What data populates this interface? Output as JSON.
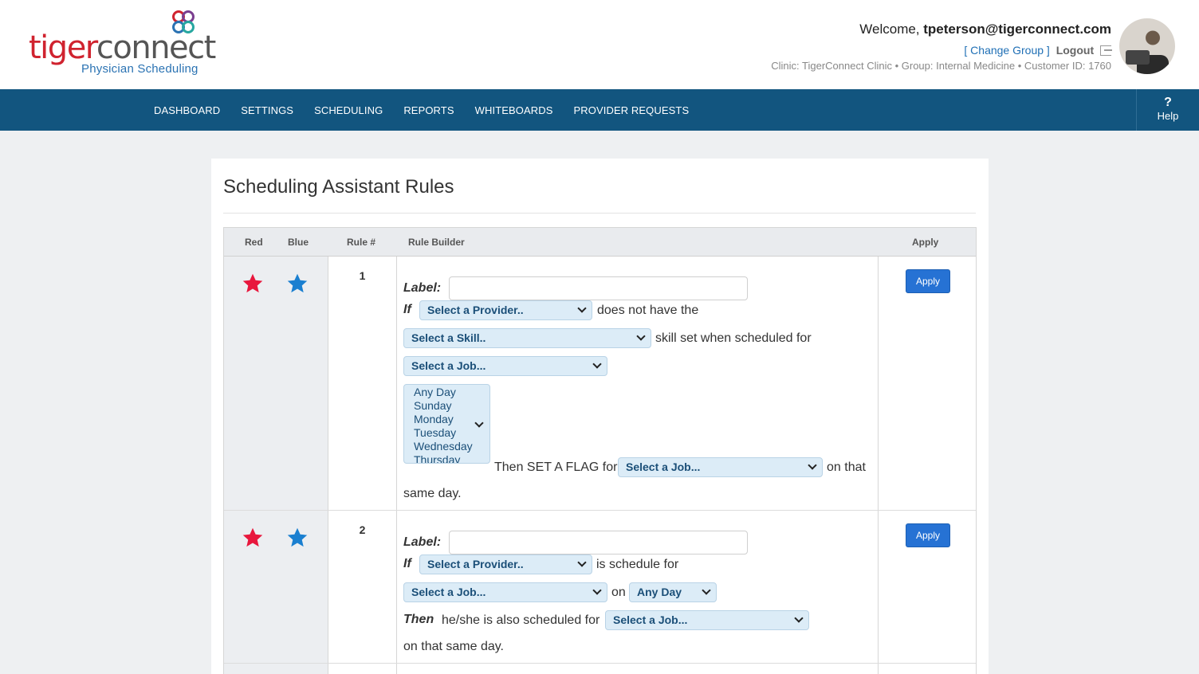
{
  "brand": {
    "name_part1": "tiger",
    "name_part2": "connect",
    "subtitle": "Physician Scheduling"
  },
  "user": {
    "welcome_prefix": "Welcome,",
    "email": "tpeterson@tigerconnect.com",
    "change_group": "[ Change Group ]",
    "logout": "Logout",
    "clinic_line": "Clinic: TigerConnect Clinic • Group: Internal Medicine • Customer ID: 1760"
  },
  "nav": {
    "items": [
      "DASHBOARD",
      "SETTINGS",
      "SCHEDULING",
      "REPORTS",
      "WHITEBOARDS",
      "PROVIDER REQUESTS"
    ],
    "help_glyph": "?",
    "help_label": "Help"
  },
  "page": {
    "title": "Scheduling Assistant Rules"
  },
  "table": {
    "headers": {
      "red": "Red",
      "blue": "Blue",
      "rule_num": "Rule #",
      "builder": "Rule Builder",
      "apply": "Apply"
    },
    "apply_label": "Apply",
    "label_text": "Label:",
    "if_text": "If",
    "colors": {
      "red_star": "#e8173d",
      "blue_star": "#1a7fd0"
    },
    "rules": [
      {
        "number": "1",
        "label_value": "",
        "provider_select": "Select a Provider..",
        "text_does_not_have": "does not have the",
        "skill_select": "Select a Skill..",
        "text_skill_set": "skill set when scheduled for",
        "job_select": "Select a Job...",
        "day_options": [
          "Any Day",
          "Sunday",
          "Monday",
          "Tuesday",
          "Wednesday",
          "Thursday"
        ],
        "text_then_flag": "Then SET A FLAG for",
        "flag_job_select": "Select a Job...",
        "text_on_that": "on that",
        "text_same_day": "same day."
      },
      {
        "number": "2",
        "label_value": "",
        "provider_select": "Select a Provider..",
        "text_is_schedule_for": "is schedule for",
        "job_select": "Select a Job...",
        "text_on": "on",
        "day_select": "Any Day",
        "then_text": "Then",
        "text_also_scheduled": "he/she is also scheduled for",
        "also_job_select": "Select a Job...",
        "text_same_day": "on that same day."
      }
    ]
  }
}
